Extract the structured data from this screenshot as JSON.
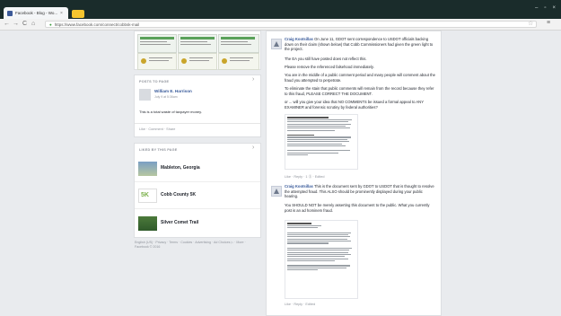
{
  "browser": {
    "tab_title": "Facebook - Blog - Wo...",
    "tab_close": "×",
    "url": "https://www.facebook.com/connect/cobbsk-mail",
    "back": "←",
    "forward": "→",
    "reload": "C",
    "home": "⌂",
    "star": "☆",
    "menu": "≡",
    "lock": "🔒",
    "win_min": "–",
    "win_max": "▫",
    "win_close": "×"
  },
  "sidebar": {
    "posts_title": "POSTS TO PAGE",
    "post_author": "William E. Harrison",
    "post_sub": "July 9 at 5:36am",
    "post_text": "This is a total waste of taxpayer money.",
    "post_actions": "Like · Comment · Share",
    "liked_title": "LIKED BY THIS PAGE",
    "pages": [
      "Mableton, Georgia",
      "Cobb County 5K",
      "Silver Comet Trail"
    ],
    "footer": "English (US) · Privacy · Terms · Cookies · Advertising · Ad Choices ▷ · More · Facebook © 2016"
  },
  "comments": [
    {
      "author": "Craig Kootsillas",
      "text": "On June 11, GDOT sent correspondence to USDOT officials backing down on their claim (shown below) that Cobb Commissioners had given the green light to the project.",
      "p2": "The EA you still have posted does not reflect this.",
      "p3": "Please remove the referenced falsehood immediately.",
      "p4": "You are in the middle of a public comment period and many people will comment about the fraud you attempted to perpetrate.",
      "p5": "To eliminate the stain that public comments will remain from the record because they refer to this fraud, PLEASE CORRECT THE DOCUMENT.",
      "p6": "or ... will you give your idea that NO COMMENTS be issued a formal appeal to ANY EXAMINER and forensic scrutiny by federal authorities?",
      "meta": "Like · Reply · 1 Ⓢ · Edited"
    },
    {
      "author": "Craig Kootsillas",
      "text": "This is the document sent by GDOT to USDOT that is thought to resolve the attempted fraud. This ALSO should be prominently displayed during your public hearing.",
      "p2": "You SHOULD NOT be merely asserting this document to the public. What you currently post is an ad hominem fraud.",
      "meta": "Like · Reply · Edited"
    }
  ]
}
